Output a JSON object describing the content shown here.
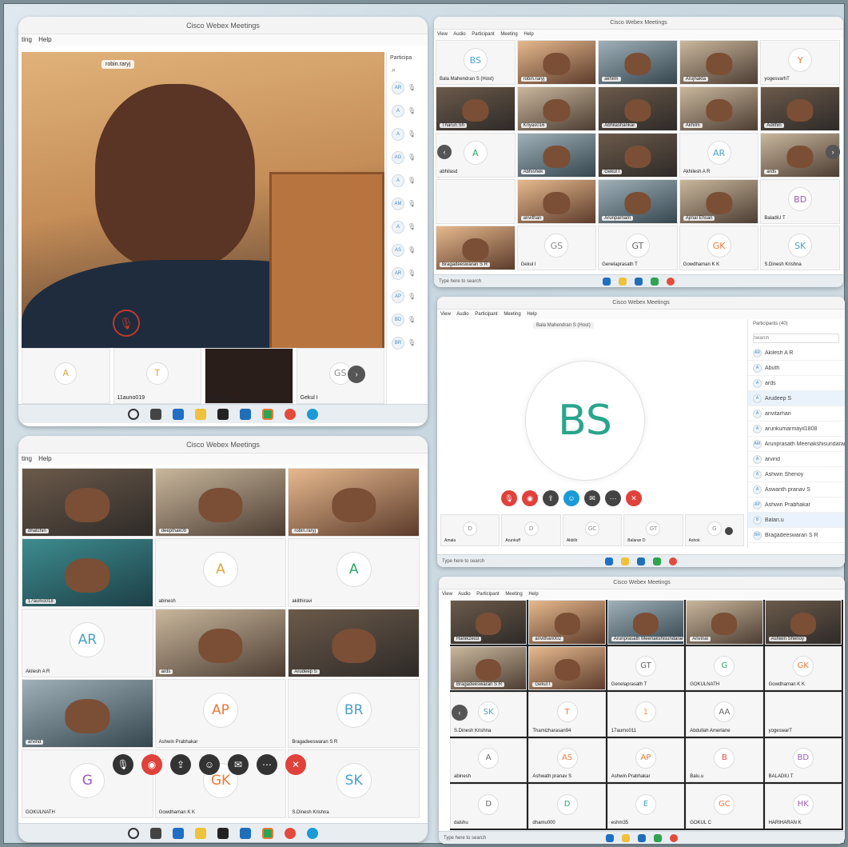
{
  "app_title": "Cisco Webex Meetings",
  "win1": {
    "menu": [
      "ting",
      "Help"
    ],
    "speaker_label": "robin.raryj",
    "panel_title": "Participa",
    "strip": [
      {
        "initials": "A",
        "name": "",
        "color": "#e1a23c"
      },
      {
        "initials": "T",
        "name": "11auno019",
        "color": "#e1a23c"
      },
      {
        "initials": "",
        "name": "robin.raryj",
        "color": ""
      },
      {
        "initials": "GS",
        "name": "Gekul I",
        "color": "#888"
      }
    ],
    "side_avatars": [
      "AR",
      "A",
      "A",
      "AG",
      "A",
      "AM",
      "A",
      "AS",
      "AR",
      "AP",
      "BD",
      "BR"
    ]
  },
  "win2": {
    "menu": [
      "View",
      "Audio",
      "Participant",
      "Meeting",
      "Help"
    ],
    "search_text": "Type here to search",
    "tiles": [
      {
        "initials": "BS",
        "name": "Bala Mahendran S (Host)",
        "color": "#4aa0c8",
        "video": false
      },
      {
        "initials": "",
        "name": "robin.raryj",
        "video": true,
        "v": "v4"
      },
      {
        "initials": "",
        "name": "akhilm",
        "video": true,
        "v": "v5"
      },
      {
        "initials": "",
        "name": "Arujhakta",
        "video": true,
        "v": "v2"
      },
      {
        "initials": "Y",
        "name": "yogesvarhT",
        "color": "#e87a3a",
        "video": false
      },
      {
        "initials": "",
        "name": "Tharun Sh",
        "video": true,
        "v": "v1"
      },
      {
        "initials": "",
        "name": "Kriyas016",
        "video": true,
        "v": "v2"
      },
      {
        "initials": "",
        "name": "Abhilashankar",
        "video": true,
        "v": "v1"
      },
      {
        "initials": "",
        "name": "Akhilm",
        "video": true,
        "v": "v2"
      },
      {
        "initials": "",
        "name": "Adithin",
        "video": true,
        "v": "v1"
      },
      {
        "initials": "A",
        "name": "abhilasd",
        "color": "#2aa56b",
        "video": false
      },
      {
        "initials": "",
        "name": "Abhishek",
        "video": true,
        "v": "v5"
      },
      {
        "initials": "",
        "name": "Gekul I",
        "video": true,
        "v": "v1"
      },
      {
        "initials": "AR",
        "name": "Akhilesh A R",
        "color": "#4aa0c8",
        "video": false
      },
      {
        "initials": "",
        "name": "ards",
        "video": true,
        "v": "v2"
      },
      {
        "initials": "",
        "name": "",
        "video": false
      },
      {
        "initials": "",
        "name": "anvithan",
        "video": true,
        "v": "v4"
      },
      {
        "initials": "",
        "name": "Arunparnam",
        "video": true,
        "v": "v5"
      },
      {
        "initials": "",
        "name": "Ajmal Ehsan",
        "video": true,
        "v": "v2"
      },
      {
        "initials": "BD",
        "name": "BaladiU T",
        "color": "#9b59b6",
        "video": false
      },
      {
        "initials": "",
        "name": "Bragadeeswaran S R",
        "video": true,
        "v": "v4"
      },
      {
        "initials": "GS",
        "name": "Gekul I",
        "color": "#888",
        "video": false
      },
      {
        "initials": "GT",
        "name": "Genelaprasath T",
        "color": "#666",
        "video": false
      },
      {
        "initials": "GK",
        "name": "Gowdhaman K K",
        "color": "#e87a3a",
        "video": false
      },
      {
        "initials": "SK",
        "name": "S.Dinesh Krishna",
        "color": "#4aa0c8",
        "video": false
      }
    ]
  },
  "win3": {
    "menu": [
      "View",
      "Audio",
      "Participant",
      "Meeting",
      "Help"
    ],
    "host_label": "Bala Mahendran S (Host)",
    "big_initials": "BS",
    "panel_title": "Participants (40)",
    "search_placeholder": "Search",
    "participants": [
      {
        "initials": "AR",
        "name": "Akilesh A R"
      },
      {
        "initials": "A",
        "name": "Abuth"
      },
      {
        "initials": "A",
        "name": "ards"
      },
      {
        "initials": "A",
        "name": "Arudeep S"
      },
      {
        "initials": "A",
        "name": "anvitarhan"
      },
      {
        "initials": "A",
        "name": "arunkumarmayil1808"
      },
      {
        "initials": "AM",
        "name": "Arunprasath Meenakshisundaram"
      },
      {
        "initials": "A",
        "name": "arvind"
      },
      {
        "initials": "A",
        "name": "Ashwin Shenoy"
      },
      {
        "initials": "A",
        "name": "Aswanth pranav S"
      },
      {
        "initials": "AP",
        "name": "Ashwin Prabhakar"
      },
      {
        "initials": "B",
        "name": "Balan.u"
      },
      {
        "initials": "BR",
        "name": "Bragadeeswaran S R"
      }
    ],
    "strip": [
      "D",
      "D",
      "GC",
      "GT",
      "G"
    ],
    "strip_names": [
      "Amala",
      "Arunkuff",
      "Akbilir",
      "Balaran D",
      "Ashok"
    ],
    "search_text": "Type here to search"
  },
  "win4": {
    "menu": [
      "ting",
      "Help"
    ],
    "tiles": [
      {
        "initials": "",
        "name": "dhatchin",
        "video": true,
        "v": "v1"
      },
      {
        "initials": "",
        "name": "deepthak09",
        "video": true,
        "v": "v2"
      },
      {
        "initials": "",
        "name": "robin.raryj",
        "video": true,
        "v": "v4"
      },
      {
        "initials": "",
        "name": "17aumo018",
        "video": true,
        "v": "v3"
      },
      {
        "initials": "A",
        "name": "abinesh",
        "color": "#e1a23c",
        "video": false
      },
      {
        "initials": "A",
        "name": "akilthiravi",
        "color": "#2aa56b",
        "video": false
      },
      {
        "initials": "AR",
        "name": "Akilesh A R",
        "color": "#4aa0c8",
        "video": false
      },
      {
        "initials": "",
        "name": "ards",
        "video": true,
        "v": "v2"
      },
      {
        "initials": "",
        "name": "Arudeep S",
        "video": true,
        "v": "v1"
      },
      {
        "initials": "",
        "name": "arvind",
        "video": true,
        "v": "v5"
      },
      {
        "initials": "AP",
        "name": "Ashwin Prabhakar",
        "color": "#e87a3a",
        "video": false
      },
      {
        "initials": "BR",
        "name": "Bragadeeswaran S R",
        "color": "#4aa0c8",
        "video": false
      },
      {
        "initials": "G",
        "name": "GOKULNATH",
        "color": "#9b59b6",
        "video": false
      },
      {
        "initials": "GK",
        "name": "Gowdhaman K K",
        "color": "#e87a3a",
        "video": false
      },
      {
        "initials": "SK",
        "name": "S.Dinesh Krishna",
        "color": "#4aa0c8",
        "video": false
      }
    ]
  },
  "win5": {
    "menu": [
      "View",
      "Audio",
      "Participant",
      "Meeting",
      "Help"
    ],
    "search_text": "Type here to search",
    "tiles": [
      {
        "initials": "",
        "name": "Hanikzeo3",
        "video": true,
        "v": "v1"
      },
      {
        "initials": "",
        "name": "anvithan002",
        "video": true,
        "v": "v4"
      },
      {
        "initials": "",
        "name": "Arunprasath Meenakshisundaram",
        "video": true,
        "v": "v5"
      },
      {
        "initials": "",
        "name": "Anvinal",
        "video": true,
        "v": "v2"
      },
      {
        "initials": "",
        "name": "Ashwin Shenoy",
        "video": true,
        "v": "v1"
      },
      {
        "initials": "",
        "name": "Bragadeeswaran S R",
        "video": true,
        "v": "v2"
      },
      {
        "initials": "",
        "name": "Gekul I",
        "video": true,
        "v": "v4"
      },
      {
        "initials": "GT",
        "name": "Genelaprasath T",
        "color": "#666",
        "video": false
      },
      {
        "initials": "G",
        "name": "GOKULNATH",
        "color": "#2aa56b",
        "video": false
      },
      {
        "initials": "GK",
        "name": "Gowdhaman K K",
        "color": "#e87a3a",
        "video": false
      },
      {
        "initials": "SK",
        "name": "S.Dinesh Krishna",
        "color": "#4aa0c8",
        "video": false
      },
      {
        "initials": "T",
        "name": "Thamizharasan94",
        "color": "#e87a3a",
        "video": false
      },
      {
        "initials": "1",
        "name": "17aumo011",
        "color": "#e1a23c",
        "video": false
      },
      {
        "initials": "AA",
        "name": "Abdullah Amerlane",
        "color": "#666",
        "video": false
      },
      {
        "initials": "",
        "name": "yogeswarT",
        "video": false
      },
      {
        "initials": "A",
        "name": "abinesh",
        "color": "#666",
        "video": false
      },
      {
        "initials": "AS",
        "name": "Ashwath pranav S",
        "color": "#e87a3a",
        "video": false
      },
      {
        "initials": "AP",
        "name": "Ashwin Prabhakar",
        "color": "#e87a3a",
        "video": false
      },
      {
        "initials": "B",
        "name": "Balu.u",
        "color": "#e84a4a",
        "video": false
      },
      {
        "initials": "BD",
        "name": "BALADIU T",
        "color": "#9b59b6",
        "video": false
      },
      {
        "initials": "D",
        "name": "dalshu",
        "color": "#666",
        "video": false
      },
      {
        "initials": "D",
        "name": "dhamu000",
        "color": "#2aa56b",
        "video": false
      },
      {
        "initials": "E",
        "name": "eshm35",
        "color": "#4aa0c8",
        "video": false
      },
      {
        "initials": "GC",
        "name": "GOKUL C",
        "color": "#e87a3a",
        "video": false
      },
      {
        "initials": "HK",
        "name": "HARIHARAN K",
        "color": "#9b59b6",
        "video": false
      }
    ]
  }
}
